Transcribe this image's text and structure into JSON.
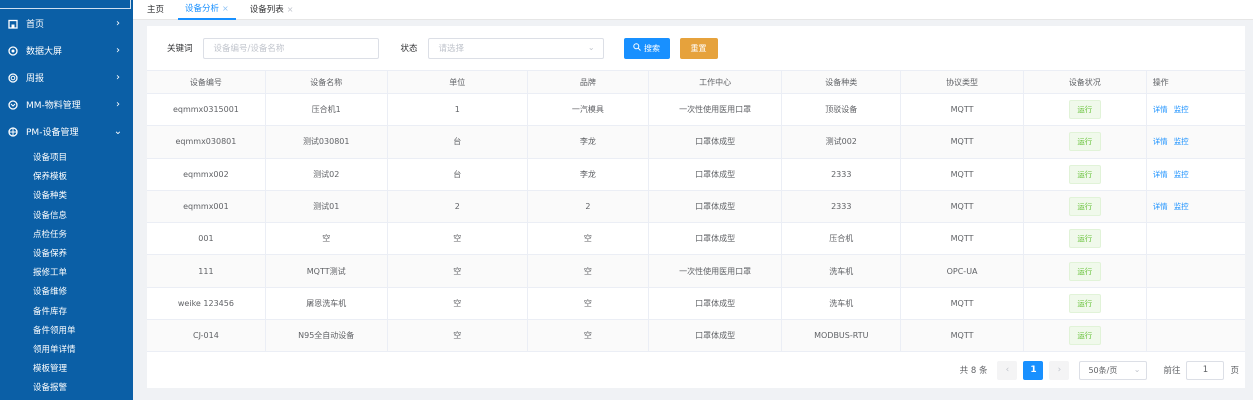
{
  "sidebar": {
    "menu": [
      {
        "label": "首页",
        "icon": "home-icon",
        "arrow": "›"
      },
      {
        "label": "数据大屏",
        "icon": "dashboard-icon",
        "arrow": "›"
      },
      {
        "label": "周报",
        "icon": "report-icon",
        "arrow": "›"
      },
      {
        "label": "MM-物料管理",
        "icon": "material-icon",
        "arrow": "›"
      },
      {
        "label": "PM-设备管理",
        "icon": "equipment-icon",
        "arrow": "⌄"
      }
    ],
    "sub_items": [
      "设备项目",
      "保养模板",
      "设备种类",
      "设备信息",
      "点检任务",
      "设备保养",
      "报修工单",
      "设备维修",
      "备件库存",
      "备件领用单",
      "领用单详情",
      "模板管理",
      "设备报警"
    ]
  },
  "tabs": [
    {
      "label": "主页",
      "closable": false
    },
    {
      "label": "设备分析",
      "closable": true,
      "close": "×"
    },
    {
      "label": "设备列表",
      "closable": true,
      "close": "×"
    }
  ],
  "filters": {
    "keyword_label": "关键词",
    "keyword_placeholder": "设备编号/设备名称",
    "status_label": "状态",
    "status_placeholder": "请选择",
    "search_label": "搜索",
    "reset_label": "重置"
  },
  "table": {
    "headers": [
      "设备编号",
      "设备名称",
      "单位",
      "品牌",
      "工作中心",
      "设备种类",
      "协议类型",
      "设备状况",
      "操作"
    ],
    "rows": [
      {
        "cells": [
          "eqmmx0315001",
          "压合机1",
          "1",
          "一汽模具",
          "一次性使用医用口罩",
          "顶驳设备",
          "MQTT"
        ],
        "status": "运行",
        "ops": [
          "详情",
          "监控"
        ]
      },
      {
        "cells": [
          "eqmmx030801",
          "测试030801",
          "台",
          "李龙",
          "口罩体成型",
          "测试002",
          "MQTT"
        ],
        "status": "运行",
        "ops": [
          "详情",
          "监控"
        ]
      },
      {
        "cells": [
          "eqmmx002",
          "测试02",
          "台",
          "李龙",
          "口罩体成型",
          "2333",
          "MQTT"
        ],
        "status": "运行",
        "ops": [
          "详情",
          "监控"
        ]
      },
      {
        "cells": [
          "eqmmx001",
          "测试01",
          "2",
          "2",
          "口罩体成型",
          "2333",
          "MQTT"
        ],
        "status": "运行",
        "ops": [
          "详情",
          "监控"
        ]
      },
      {
        "cells": [
          "001",
          "空",
          "空",
          "空",
          "口罩体成型",
          "压合机",
          "MQTT"
        ],
        "status": "运行",
        "ops": []
      },
      {
        "cells": [
          "111",
          "MQTT测试",
          "空",
          "空",
          "一次性使用医用口罩",
          "洗车机",
          "OPC-UA"
        ],
        "status": "运行",
        "ops": []
      },
      {
        "cells": [
          "weike 123456",
          "屠恩洗车机",
          "空",
          "空",
          "口罩体成型",
          "洗车机",
          "MQTT"
        ],
        "status": "运行",
        "ops": []
      },
      {
        "cells": [
          "CJ-014",
          "N95全自动设备",
          "空",
          "空",
          "口罩体成型",
          "MODBUS-RTU",
          "MQTT"
        ],
        "status": "运行",
        "ops": []
      }
    ]
  },
  "pagination": {
    "total_text": "共 8 条",
    "prev": "‹",
    "next": "›",
    "current_page": "1",
    "page_size": "50条/页",
    "goto_label": "前往",
    "goto_value": "1",
    "page_unit": "页"
  },
  "colors": {
    "sidebar": "#0b5fa6",
    "primary": "#1890ff",
    "reset": "#e6a23c",
    "success": "#67c23a"
  }
}
